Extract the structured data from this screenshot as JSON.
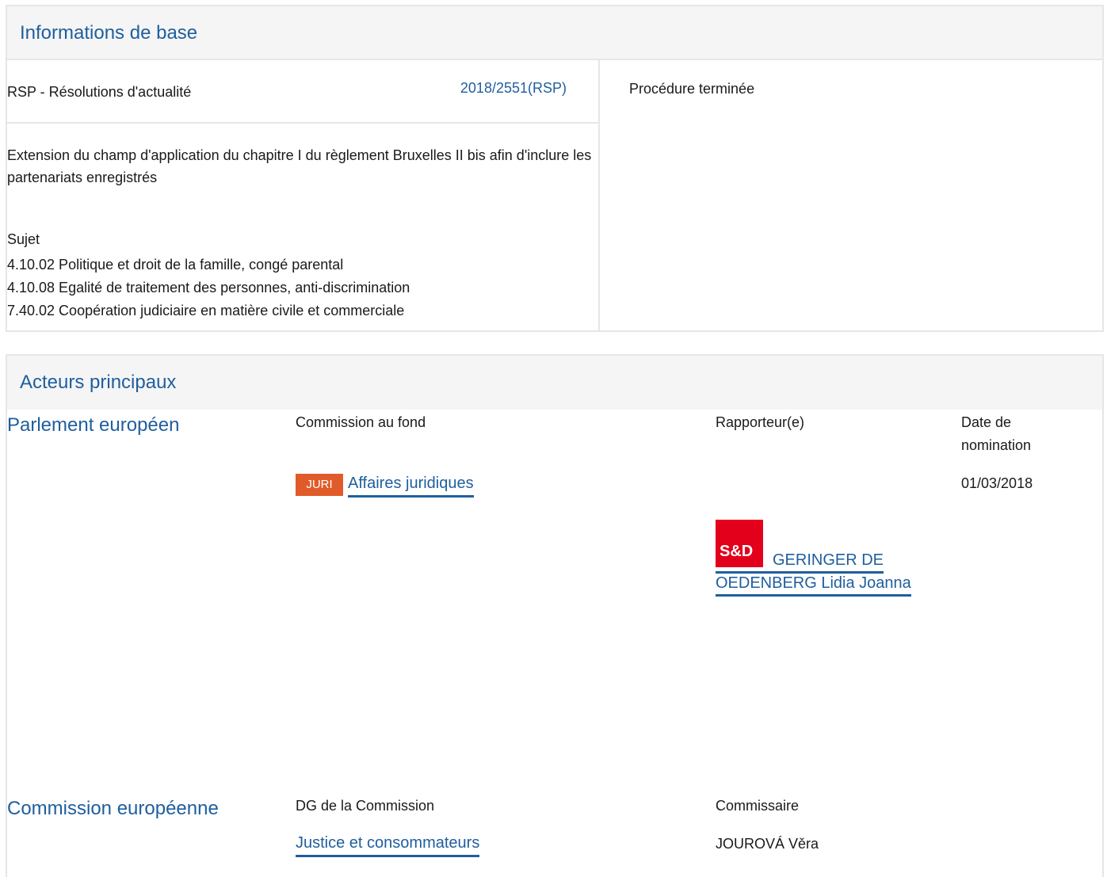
{
  "basic": {
    "header": "Informations de base",
    "procedure_type": "RSP - Résolutions d'actualité",
    "procedure_ref": "2018/2551(RSP)",
    "status": "Procédure terminée",
    "title": "Extension du champ d'application du chapitre I du règlement Bruxelles II bis afin d'inclure les partenariats enregistrés",
    "subject_label": "Sujet",
    "subjects": [
      "4.10.02 Politique et droit de la famille, congé parental",
      "4.10.08 Egalité de traitement des personnes, anti-discrimination",
      "7.40.02 Coopération judiciaire en matière civile et commerciale"
    ]
  },
  "actors": {
    "header": "Acteurs principaux",
    "parliament": {
      "label": "Parlement européen",
      "committee_header": "Commission au fond",
      "rapporteur_header": "Rapporteur(e)",
      "date_header": "Date de nomination",
      "committee_code": "JURI",
      "committee_name": "Affaires juridiques",
      "date": "01/03/2018",
      "group_logo": "S&D",
      "rapporteur_name": "GERINGER DE OEDENBERG Lidia Joanna"
    },
    "commission": {
      "label": "Commission européenne",
      "dg_header": "DG de la Commission",
      "commissioner_header": "Commissaire",
      "dg_name": "Justice et consommateurs",
      "commissioner_name": "JOUROVÁ Věra"
    }
  }
}
